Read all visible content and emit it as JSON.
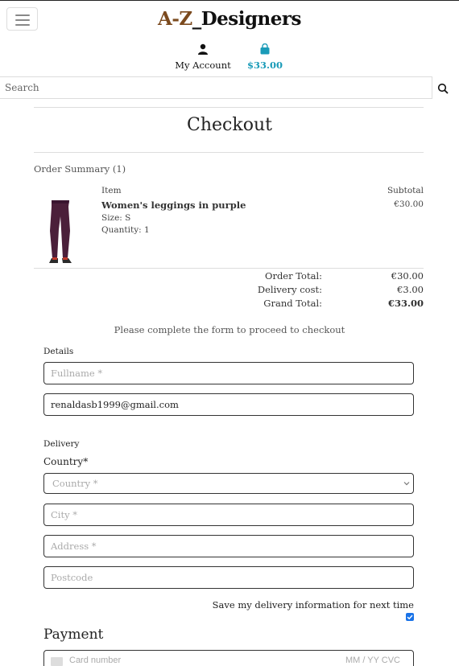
{
  "header": {
    "brand_prefix": "A-Z",
    "brand_suffix": "_Designers",
    "account_label": "My Account",
    "bag_total": "$33.00",
    "search_placeholder": "Search",
    "accent_color": "#1a9bb8",
    "brand_color": "#7b4a1e"
  },
  "page": {
    "title": "Checkout"
  },
  "order": {
    "summary_label": "Order Summary (1)",
    "col_item": "Item",
    "col_subtotal": "Subtotal",
    "items": [
      {
        "name": "Women's leggings in purple",
        "size": "Size: S",
        "quantity": "Quantity: 1",
        "subtotal": "€30.00",
        "image_icon": "purple-leggings-image"
      }
    ],
    "order_total_label": "Order Total:",
    "order_total_value": "€30.00",
    "delivery_label": "Delivery cost:",
    "delivery_value": "€3.00",
    "grand_total_label": "Grand Total:",
    "grand_total_value": "€33.00"
  },
  "form": {
    "notice": "Please complete the form to proceed to checkout",
    "details_legend": "Details",
    "fullname_placeholder": "Fullname *",
    "email_value": "renaldasb1999@gmail.com",
    "delivery_legend": "Delivery",
    "country_label": "Country*",
    "country_placeholder": "Country *",
    "city_placeholder": "City *",
    "address_placeholder": "Address *",
    "postcode_placeholder": "Postcode",
    "save_info_label": "Save my delivery information for next time",
    "save_info_checked": true,
    "payment_title": "Payment",
    "card_placeholder": "Card number",
    "card_exp_placeholder": "MM / YY  CVC"
  }
}
